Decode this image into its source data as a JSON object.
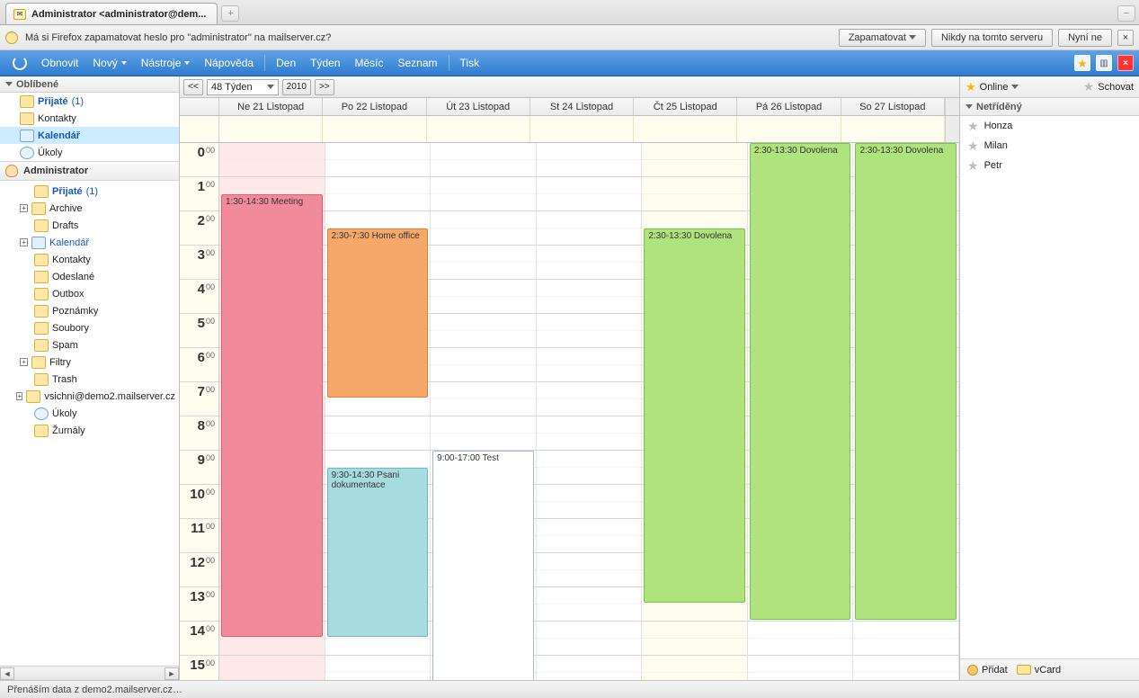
{
  "browser": {
    "tab_title": "Administrator <administrator@dem...",
    "tab_plus": "+",
    "minimize": "−"
  },
  "infobar": {
    "prompt": "Má si Firefox zapamatovat heslo pro \"administrator\" na mailserver.cz?",
    "btn_save": "Zapamatovat",
    "btn_never": "Nikdy na tomto serveru",
    "btn_notnow": "Nyní ne",
    "close": "×"
  },
  "toolbar": {
    "refresh": "Obnovit",
    "new": "Nový",
    "tools": "Nástroje",
    "help": "Nápověda",
    "view_day": "Den",
    "view_week": "Týden",
    "view_month": "Měsíc",
    "view_list": "Seznam",
    "print": "Tisk"
  },
  "sidebar": {
    "favorites_header": "Oblíbené",
    "favorites": [
      {
        "label": "Přijaté",
        "count": "(1)"
      },
      {
        "label": "Kontakty"
      },
      {
        "label": "Kalendář"
      },
      {
        "label": "Úkoly"
      }
    ],
    "account_label": "Administrator",
    "account_items": [
      {
        "label": "Přijaté",
        "count": "(1)",
        "indent": 1,
        "icon": "folder"
      },
      {
        "label": "Archive",
        "indent": 1,
        "icon": "folder",
        "exp": true
      },
      {
        "label": "Drafts",
        "indent": 1,
        "icon": "folder"
      },
      {
        "label": "Kalendář",
        "indent": 1,
        "icon": "cal",
        "exp": true,
        "hl": true
      },
      {
        "label": "Kontakty",
        "indent": 1,
        "icon": "contacts"
      },
      {
        "label": "Odeslané",
        "indent": 1,
        "icon": "folder"
      },
      {
        "label": "Outbox",
        "indent": 1,
        "icon": "folder"
      },
      {
        "label": "Poznámky",
        "indent": 1,
        "icon": "folder"
      },
      {
        "label": "Soubory",
        "indent": 1,
        "icon": "folder"
      },
      {
        "label": "Spam",
        "indent": 1,
        "icon": "spam"
      },
      {
        "label": "Filtry",
        "indent": 1,
        "icon": "folder",
        "exp": true
      },
      {
        "label": "Trash",
        "indent": 1,
        "icon": "folder"
      },
      {
        "label": "vsichni@demo2.mailserver.cz",
        "indent": 1,
        "icon": "folder",
        "exp": true
      },
      {
        "label": "Úkoly",
        "indent": 1,
        "icon": "clock"
      },
      {
        "label": "Žurnály",
        "indent": 1,
        "icon": "folder"
      }
    ]
  },
  "calendar": {
    "prev": "<<",
    "next": ">>",
    "week_label": "48 Týden",
    "year": "2010",
    "day_headers": [
      "Ne 21 Listopad",
      "Po 22 Listopad",
      "Út 23 Listopad",
      "St 24 Listopad",
      "Čt 25 Listopad",
      "Pá 26 Listopad",
      "So 27 Listopad"
    ],
    "hours": [
      "0",
      "1",
      "2",
      "3",
      "4",
      "5",
      "6",
      "7",
      "8",
      "9",
      "10",
      "11",
      "12",
      "13",
      "14",
      "15"
    ],
    "minute_suffix": "00",
    "events": [
      {
        "day": 0,
        "start": 1.5,
        "end": 14.5,
        "text": "1:30-14:30 Meeting",
        "cls": "ev-pink"
      },
      {
        "day": 1,
        "start": 2.5,
        "end": 7.5,
        "text": "2:30-7:30 Home office",
        "cls": "ev-orange"
      },
      {
        "day": 1,
        "start": 9.5,
        "end": 14.5,
        "text": "9:30-14:30 Psani dokumentace",
        "cls": "ev-teal"
      },
      {
        "day": 2,
        "start": 9.0,
        "end": 17.0,
        "text": "9:00-17:00 Test",
        "cls": "ev-white"
      },
      {
        "day": 4,
        "start": 2.5,
        "end": 13.5,
        "text": "2:30-13:30 Dovolena",
        "cls": "ev-green"
      }
    ],
    "allday_events": [
      {
        "day": 5,
        "text": "2:30-13:30 Dovolena",
        "cls": "ev-green",
        "rows": 14
      },
      {
        "day": 6,
        "text": "2:30-13:30 Dovolena",
        "cls": "ev-green",
        "rows": 14
      }
    ]
  },
  "right": {
    "online": "Online",
    "hide": "Schovat",
    "group": "Netříděný",
    "contacts": [
      "Honza",
      "Milan",
      "Petr"
    ],
    "add": "Přidat",
    "vcard": "vCard"
  },
  "status": {
    "text": "Přenáším data z demo2.mailserver.cz…"
  }
}
